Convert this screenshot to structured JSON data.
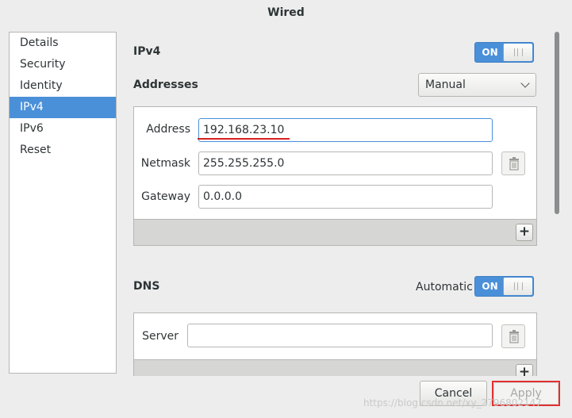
{
  "window": {
    "title": "Wired"
  },
  "sidebar": {
    "items": [
      {
        "label": "Details"
      },
      {
        "label": "Security"
      },
      {
        "label": "Identity"
      },
      {
        "label": "IPv4",
        "selected": true
      },
      {
        "label": "IPv6"
      },
      {
        "label": "Reset"
      }
    ]
  },
  "ipv4": {
    "title": "IPv4",
    "toggle": {
      "label": "ON",
      "state": "on"
    },
    "addresses_label": "Addresses",
    "method": "Manual",
    "address_label": "Address",
    "address_value": "192.168.23.10",
    "netmask_label": "Netmask",
    "netmask_value": "255.255.255.0",
    "gateway_label": "Gateway",
    "gateway_value": "0.0.0.0",
    "add_symbol": "+"
  },
  "dns": {
    "title": "DNS",
    "automatic_label": "Automatic",
    "toggle": {
      "label": "ON",
      "state": "on"
    },
    "server_label": "Server",
    "server_value": "",
    "add_symbol": "+"
  },
  "footer": {
    "cancel_label": "Cancel",
    "apply_label": "Apply"
  },
  "watermark": "https://blog.csdn.net/xy_2796802147",
  "colors": {
    "accent": "#4a90d9",
    "highlight_red": "#d62020"
  }
}
